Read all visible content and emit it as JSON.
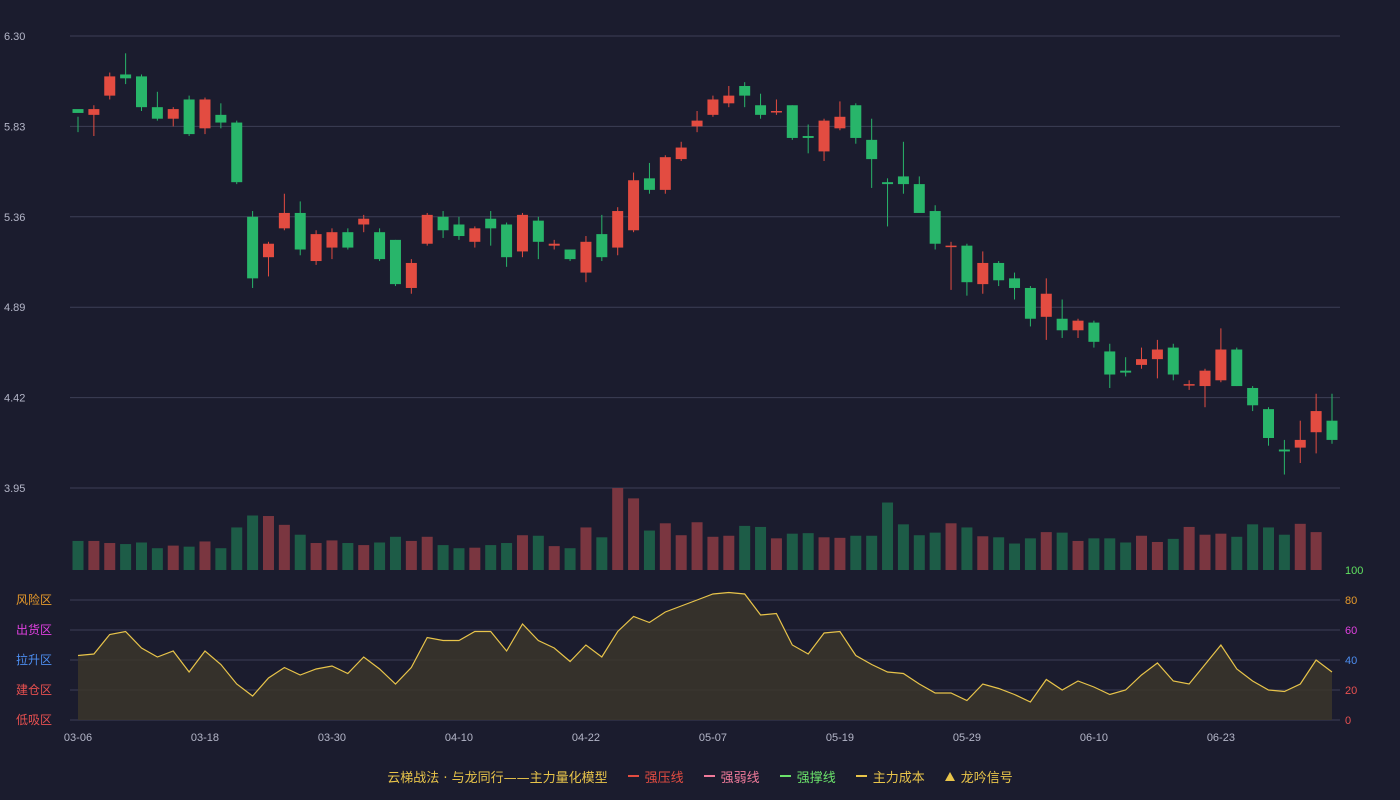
{
  "chart_data": {
    "type": "candlestick",
    "price_axis": {
      "min": 3.95,
      "max": 6.3,
      "ticks": [
        "6.30",
        "5.83",
        "5.36",
        "4.89",
        "4.42",
        "3.95"
      ]
    },
    "x_ticks": [
      {
        "i": 0,
        "label": "03-06"
      },
      {
        "i": 8,
        "label": "03-18"
      },
      {
        "i": 16,
        "label": "03-30"
      },
      {
        "i": 24,
        "label": "04-10"
      },
      {
        "i": 32,
        "label": "04-22"
      },
      {
        "i": 40,
        "label": "05-07"
      },
      {
        "i": 48,
        "label": "05-19"
      },
      {
        "i": 56,
        "label": "05-29"
      },
      {
        "i": 64,
        "label": "06-10"
      },
      {
        "i": 72,
        "label": "06-23"
      }
    ],
    "candles": [
      [
        5.92,
        5.9,
        5.88,
        5.8
      ],
      [
        5.89,
        5.92,
        5.94,
        5.78
      ],
      [
        5.99,
        6.09,
        6.11,
        5.97
      ],
      [
        6.1,
        6.08,
        6.21,
        6.05
      ],
      [
        6.09,
        5.93,
        6.1,
        5.91
      ],
      [
        5.93,
        5.87,
        6.01,
        5.86
      ],
      [
        5.87,
        5.92,
        5.93,
        5.83
      ],
      [
        5.97,
        5.79,
        5.99,
        5.78
      ],
      [
        5.82,
        5.97,
        5.98,
        5.79
      ],
      [
        5.89,
        5.85,
        5.95,
        5.82
      ],
      [
        5.85,
        5.54,
        5.86,
        5.53
      ],
      [
        5.36,
        5.04,
        5.39,
        4.99
      ],
      [
        5.15,
        5.22,
        5.23,
        5.05
      ],
      [
        5.3,
        5.38,
        5.48,
        5.29
      ],
      [
        5.38,
        5.19,
        5.44,
        5.16
      ],
      [
        5.13,
        5.27,
        5.29,
        5.11
      ],
      [
        5.2,
        5.28,
        5.3,
        5.14
      ],
      [
        5.28,
        5.2,
        5.3,
        5.19
      ],
      [
        5.32,
        5.35,
        5.37,
        5.28
      ],
      [
        5.28,
        5.14,
        5.3,
        5.13
      ],
      [
        5.24,
        5.01,
        5.24,
        5.0
      ],
      [
        4.99,
        5.12,
        5.14,
        4.96
      ],
      [
        5.22,
        5.37,
        5.38,
        5.21
      ],
      [
        5.36,
        5.29,
        5.39,
        5.25
      ],
      [
        5.32,
        5.26,
        5.36,
        5.24
      ],
      [
        5.23,
        5.3,
        5.31,
        5.2
      ],
      [
        5.35,
        5.3,
        5.39,
        5.21
      ],
      [
        5.32,
        5.15,
        5.33,
        5.1
      ],
      [
        5.18,
        5.37,
        5.38,
        5.15
      ],
      [
        5.34,
        5.23,
        5.36,
        5.14
      ],
      [
        5.21,
        5.22,
        5.24,
        5.19
      ],
      [
        5.19,
        5.14,
        5.19,
        5.13
      ],
      [
        5.07,
        5.23,
        5.26,
        5.02
      ],
      [
        5.27,
        5.15,
        5.37,
        5.13
      ],
      [
        5.2,
        5.39,
        5.41,
        5.16
      ],
      [
        5.29,
        5.55,
        5.59,
        5.28
      ],
      [
        5.56,
        5.5,
        5.64,
        5.48
      ],
      [
        5.5,
        5.67,
        5.68,
        5.48
      ],
      [
        5.66,
        5.72,
        5.75,
        5.65
      ],
      [
        5.83,
        5.86,
        5.91,
        5.8
      ],
      [
        5.89,
        5.97,
        5.99,
        5.88
      ],
      [
        5.95,
        5.99,
        6.04,
        5.93
      ],
      [
        6.04,
        5.99,
        6.06,
        5.93
      ],
      [
        5.94,
        5.89,
        6.0,
        5.87
      ],
      [
        5.91,
        5.91,
        5.97,
        5.89
      ],
      [
        5.94,
        5.77,
        5.94,
        5.76
      ],
      [
        5.78,
        5.77,
        5.84,
        5.69
      ],
      [
        5.7,
        5.86,
        5.87,
        5.65
      ],
      [
        5.82,
        5.88,
        5.96,
        5.81
      ],
      [
        5.94,
        5.77,
        5.95,
        5.74
      ],
      [
        5.76,
        5.66,
        5.87,
        5.51
      ],
      [
        5.54,
        5.53,
        5.56,
        5.31
      ],
      [
        5.57,
        5.53,
        5.75,
        5.48
      ],
      [
        5.53,
        5.38,
        5.57,
        5.44
      ],
      [
        5.39,
        5.22,
        5.42,
        5.19
      ],
      [
        5.21,
        5.21,
        5.23,
        4.98
      ],
      [
        5.21,
        5.02,
        5.22,
        4.95
      ],
      [
        5.01,
        5.12,
        5.18,
        4.96
      ],
      [
        5.12,
        5.03,
        5.13,
        5.0
      ],
      [
        5.04,
        4.99,
        5.07,
        4.93
      ],
      [
        4.99,
        4.83,
        5.0,
        4.79
      ],
      [
        4.84,
        4.96,
        5.04,
        4.72
      ],
      [
        4.83,
        4.77,
        4.93,
        4.73
      ],
      [
        4.77,
        4.82,
        4.83,
        4.73
      ],
      [
        4.81,
        4.71,
        4.82,
        4.68
      ],
      [
        4.66,
        4.54,
        4.7,
        4.47
      ],
      [
        4.56,
        4.55,
        4.63,
        4.53
      ],
      [
        4.59,
        4.62,
        4.68,
        4.57
      ],
      [
        4.62,
        4.67,
        4.72,
        4.52
      ],
      [
        4.68,
        4.54,
        4.7,
        4.51
      ],
      [
        4.49,
        4.49,
        4.51,
        4.46
      ],
      [
        4.48,
        4.56,
        4.57,
        4.37
      ],
      [
        4.51,
        4.67,
        4.78,
        4.5
      ],
      [
        4.67,
        4.48,
        4.68,
        4.48
      ],
      [
        4.47,
        4.38,
        4.48,
        4.35
      ],
      [
        4.36,
        4.21,
        4.37,
        4.17
      ],
      [
        4.15,
        4.14,
        4.2,
        4.02
      ],
      [
        4.16,
        4.2,
        4.3,
        4.08
      ],
      [
        4.24,
        4.35,
        4.44,
        4.13
      ],
      [
        4.3,
        4.2,
        4.44,
        4.18
      ]
    ],
    "volume": [
      56,
      56,
      52,
      50,
      53,
      42,
      47,
      45,
      55,
      42,
      82,
      105,
      104,
      87,
      68,
      52,
      57,
      52,
      48,
      53,
      64,
      56,
      64,
      48,
      42,
      43,
      48,
      52,
      67,
      66,
      46,
      42,
      82,
      63,
      158,
      138,
      76,
      90,
      67,
      92,
      64,
      66,
      85,
      83,
      61,
      70,
      71,
      63,
      62,
      66,
      66,
      130,
      88,
      67,
      72,
      90,
      82,
      65,
      63,
      51,
      61,
      73,
      72,
      56,
      61,
      61,
      53,
      66,
      54,
      60,
      83,
      68,
      70,
      64,
      88,
      82,
      68,
      89,
      73
    ],
    "oscillator": {
      "axis_ticks": [
        "100",
        "80",
        "60",
        "40",
        "20",
        "0"
      ],
      "zone_labels": [
        "风险区",
        "出货区",
        "拉升区",
        "建仓区",
        "低吸区"
      ],
      "values": [
        43,
        44,
        57,
        59,
        48,
        42,
        46,
        32,
        46,
        37,
        24,
        16,
        28,
        35,
        30,
        34,
        36,
        31,
        42,
        34,
        24,
        35,
        55,
        53,
        53,
        59,
        59,
        46,
        64,
        53,
        48,
        39,
        50,
        42,
        59,
        69,
        65,
        72,
        76,
        80,
        84,
        85,
        84,
        70,
        71,
        50,
        44,
        58,
        59,
        43,
        37,
        32,
        31,
        24,
        18,
        18,
        13,
        24,
        21,
        17,
        12,
        27,
        20,
        26,
        22,
        17,
        20,
        30,
        38,
        26,
        24,
        37,
        50,
        34,
        26,
        20,
        19,
        24,
        40,
        32
      ]
    },
    "legend": {
      "title": "云梯战法 · 与龙同行——主力量化模型",
      "items": [
        {
          "label": "强压线",
          "style": "solid",
          "color": "#e34c41"
        },
        {
          "label": "强弱线",
          "style": "dash",
          "color": "#f07a9a"
        },
        {
          "label": "强撑线",
          "style": "solid",
          "color": "#6be26b"
        },
        {
          "label": "主力成本",
          "style": "dash",
          "color": "#e8c44a"
        },
        {
          "label": "龙吟信号",
          "style": "triangle",
          "color": "#e8c44a"
        }
      ]
    },
    "colors": {
      "background": "#1b1c2e",
      "up": "#e34c41",
      "down": "#28b56a",
      "volume_up": "#7a3640",
      "volume_down": "#1d5c47",
      "line": "#e8c44a",
      "area": "#3a352a",
      "grid": "#3c3e56",
      "axis_label": "#b4b6c8",
      "zone_risk": "#e89a2a",
      "zone_sell": "#e040e0",
      "zone_pump": "#4c8df0",
      "zone_build": "#e85050",
      "zone_buy": "#e85050",
      "osc_100": "#5fe05f",
      "osc_80": "#e89a2a",
      "osc_60": "#e040e0",
      "osc_40": "#4c8df0",
      "osc_20": "#e85050",
      "osc_0": "#e85050"
    }
  }
}
